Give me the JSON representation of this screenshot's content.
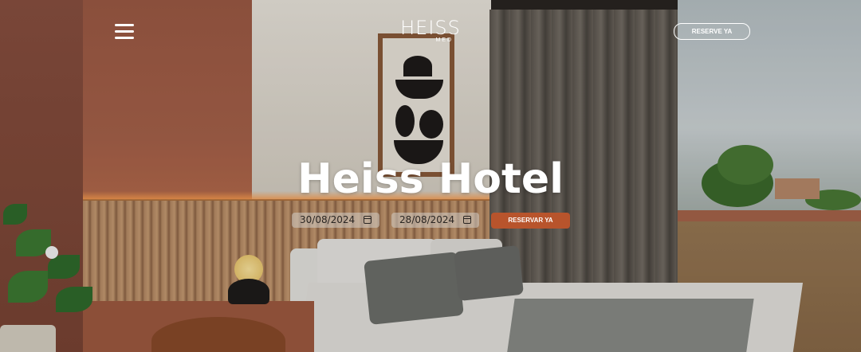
{
  "header": {
    "menu_icon": "hamburger-menu-icon",
    "logo": {
      "main": "HEISS",
      "sub": "MED"
    },
    "reserve_button_label": "RESERVE YA"
  },
  "hero": {
    "title": "Heiss Hotel",
    "checkin_date": "30/08/2024",
    "checkout_date": "28/08/2024",
    "date_icon": "calendar-icon",
    "reserve_button_label": "RESERVAR YA"
  },
  "colors": {
    "accent": "#b8542c",
    "text": "#ffffff"
  }
}
